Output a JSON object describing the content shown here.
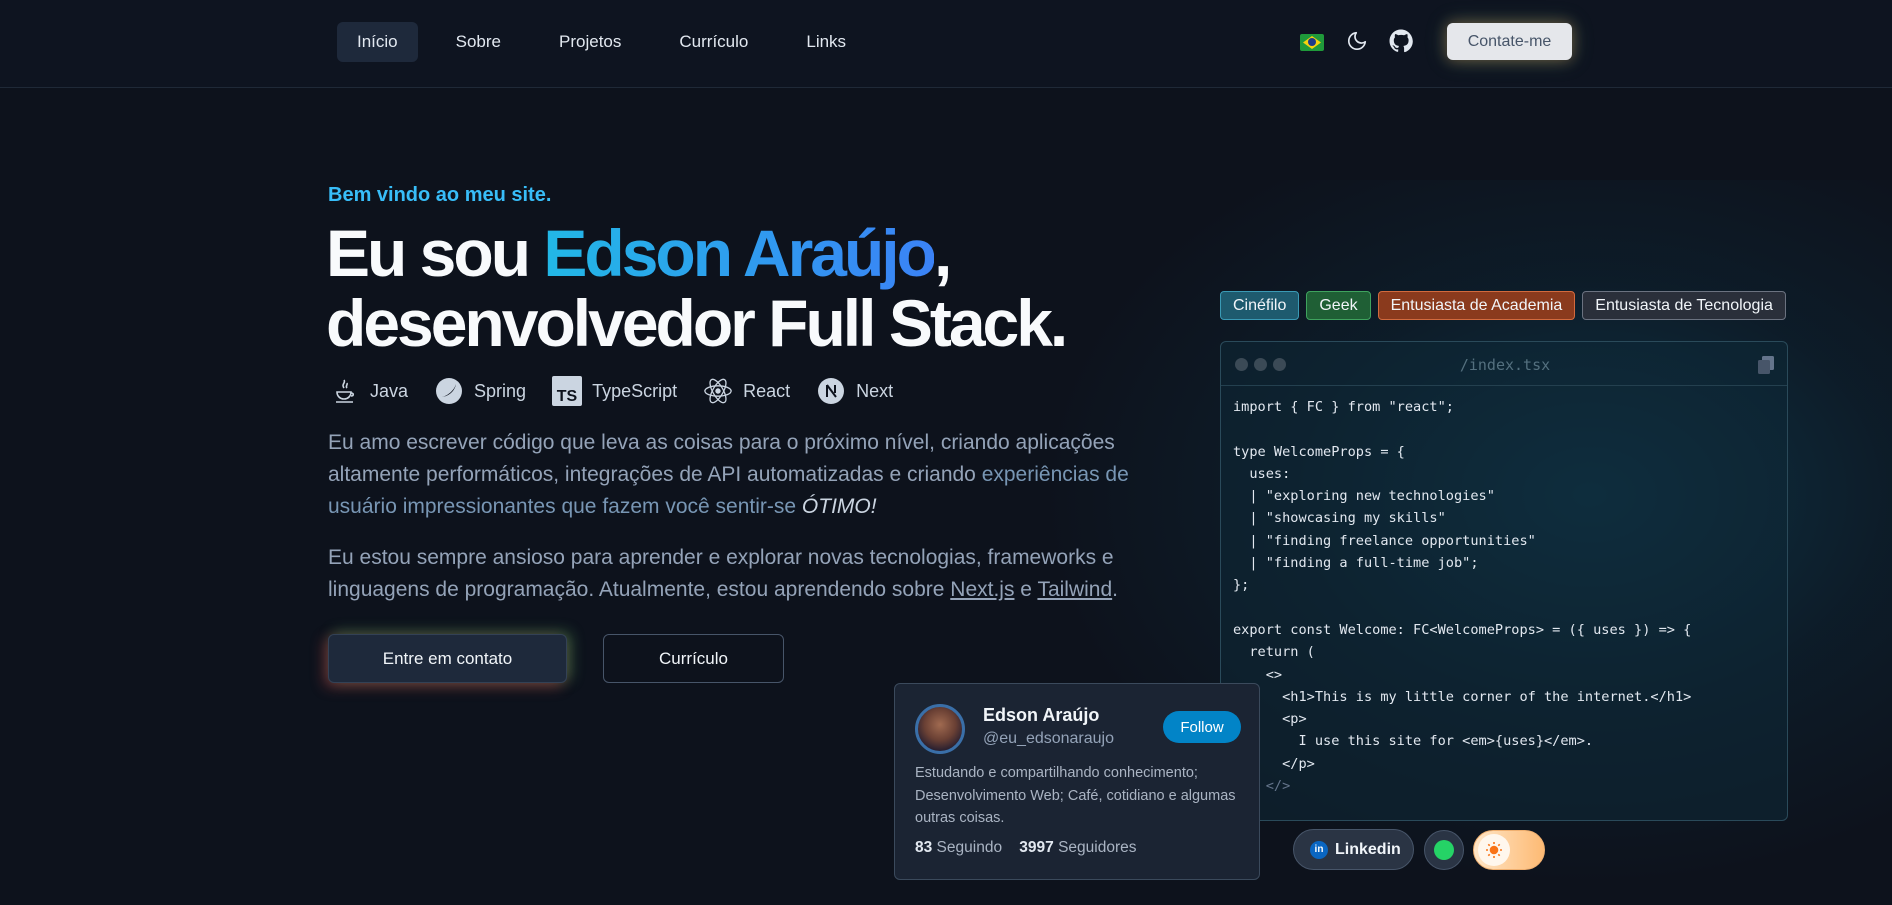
{
  "nav": {
    "items": [
      {
        "label": "Início",
        "active": true
      },
      {
        "label": "Sobre"
      },
      {
        "label": "Projetos"
      },
      {
        "label": "Currículo"
      },
      {
        "label": "Links"
      }
    ],
    "contact_label": "Contate-me",
    "icons": [
      "brazil-flag-icon",
      "moon-icon",
      "github-icon"
    ]
  },
  "hero": {
    "welcome": "Bem vindo ao meu site.",
    "headline_prefix": "Eu sou ",
    "name": "Edson Araújo",
    "headline_comma": ",",
    "headline_line2": "desenvolvedor Full Stack.",
    "stack": [
      {
        "label": "Java",
        "icon": "java-icon"
      },
      {
        "label": "Spring",
        "icon": "spring-icon"
      },
      {
        "label": "TypeScript",
        "icon": "typescript-icon"
      },
      {
        "label": "React",
        "icon": "react-icon"
      },
      {
        "label": "Next",
        "icon": "nextjs-icon"
      }
    ],
    "para1_a": "Eu amo escrever código que leva as coisas para o próximo nível, criando aplicações altamente performáticos, integrações de API automatizadas e criando ",
    "para1_b": "experiências de usuário impressionantes que fazem você sentir-se ",
    "para1_em": "ÓTIMO!",
    "para2_a": "Eu estou sempre ansioso para aprender e explorar novas tecnologias, frameworks e linguagens de programação. Atualmente, estou aprendendo sobre ",
    "para2_link1": "Next.js",
    "para2_and": " e ",
    "para2_link2": "Tailwind",
    "para2_end": ".",
    "btn_contact": "Entre em contato",
    "btn_cv": "Currículo"
  },
  "tags": [
    "Cinéfilo",
    "Geek",
    "Entusiasta de Academia",
    "Entusiasta de Tecnologia"
  ],
  "code": {
    "filename": "/index.tsx",
    "lines": [
      "import { FC } from \"react\";",
      "",
      "type WelcomeProps = {",
      "  uses:",
      "  | \"exploring new technologies\"",
      "  | \"showcasing my skills\"",
      "  | \"finding freelance opportunities\"",
      "  | \"finding a full-time job\";",
      "};",
      "",
      "export const Welcome: FC<WelcomeProps> = ({ uses }) => {",
      "  return (",
      "    <>",
      "      <h1>This is my little corner of the internet.</h1>",
      "      <p>",
      "        I use this site for <em>{uses}</em>.",
      "      </p>",
      "    </>"
    ]
  },
  "profile": {
    "name": "Edson Araújo",
    "handle": "@eu_edsonaraujo",
    "follow": "Follow",
    "bio": "Estudando e compartilhando conhecimento; Desenvolvimento Web; Café, cotidiano e algumas outras coisas.",
    "following_count": "83",
    "following_label": " Seguindo",
    "followers_count": "3997",
    "followers_label": " Seguidores"
  },
  "social": {
    "linkedin_label": "Linkedin",
    "linkedin_icon_text": "in"
  }
}
